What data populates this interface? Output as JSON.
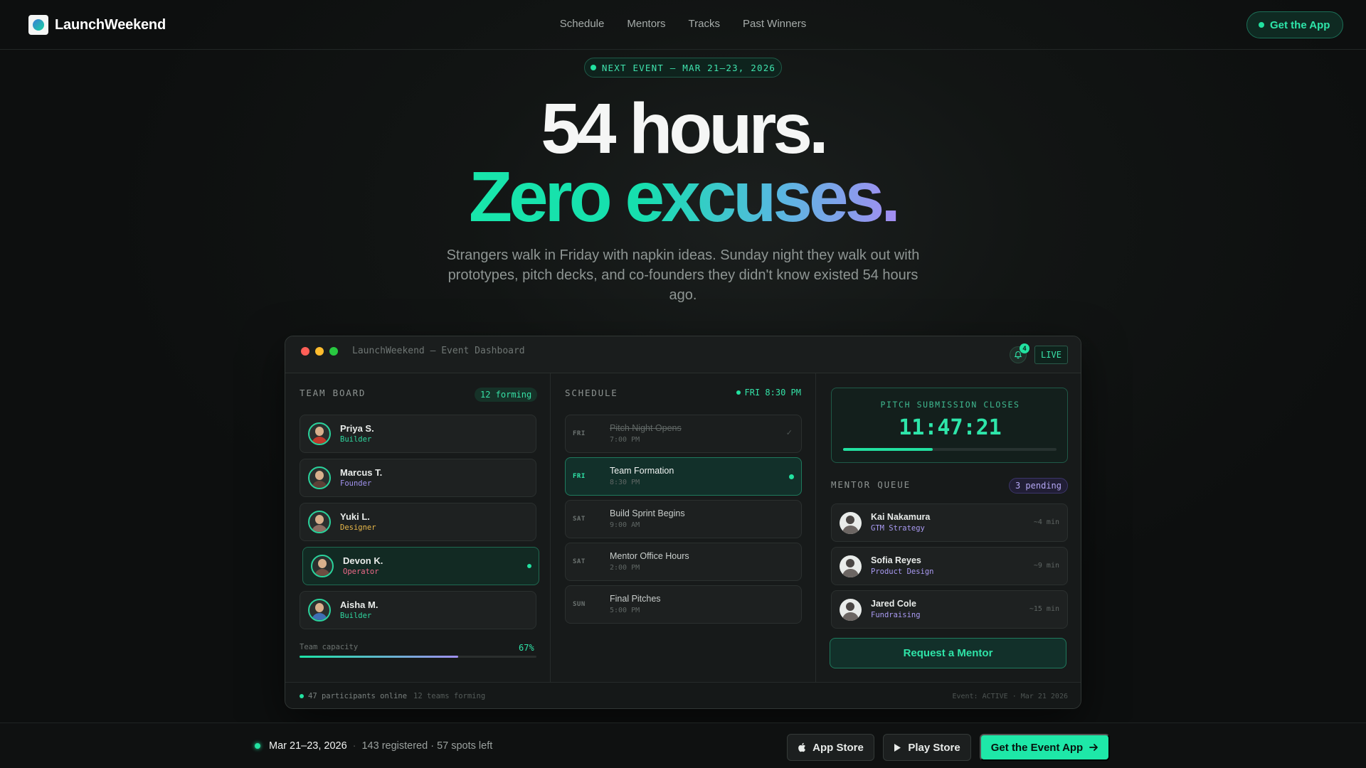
{
  "nav": {
    "brand": "LaunchWeekend",
    "links": [
      "Schedule",
      "Mentors",
      "Tracks",
      "Past Winners"
    ],
    "cta": "Get the App"
  },
  "hero": {
    "event_pill": "NEXT EVENT — MAR 21–23, 2026",
    "line1": "54 hours.",
    "line2": "Zero excuses.",
    "subtitle": "Strangers walk in Friday with napkin ideas. Sunday night they walk out with prototypes, pitch decks, and co-founders they didn't know existed 54 hours ago."
  },
  "dashboard": {
    "window_title": "LaunchWeekend — Event Dashboard",
    "notification_count": "4",
    "live_label": "LIVE",
    "team_board": {
      "title": "TEAM BOARD",
      "badge": "12 forming",
      "members": [
        {
          "name": "Priya S.",
          "role": "Builder",
          "role_color": "#2fd79f",
          "avatar_color": "#c0392b",
          "active": false
        },
        {
          "name": "Marcus T.",
          "role": "Founder",
          "role_color": "#a193f0",
          "avatar_color": "#5d4037",
          "active": false
        },
        {
          "name": "Yuki L.",
          "role": "Designer",
          "role_color": "#e8b84a",
          "avatar_color": "#8d6e63",
          "active": false
        },
        {
          "name": "Devon K.",
          "role": "Operator",
          "role_color": "#f06a8a",
          "avatar_color": "#6d4c41",
          "active": true
        },
        {
          "name": "Aisha M.",
          "role": "Builder",
          "role_color": "#2fd79f",
          "avatar_color": "#3f6fb5",
          "active": false
        }
      ],
      "capacity_label": "Team capacity",
      "capacity_value": "67%",
      "capacity_fraction": 0.67
    },
    "schedule": {
      "title": "SCHEDULE",
      "now": "FRI 8:30 PM",
      "items": [
        {
          "day": "FRI",
          "title": "Pitch Night Opens",
          "time": "7:00 PM",
          "state": "done"
        },
        {
          "day": "FRI",
          "title": "Team Formation",
          "time": "8:30 PM",
          "state": "current"
        },
        {
          "day": "SAT",
          "title": "Build Sprint Begins",
          "time": "9:00 AM",
          "state": "upcoming"
        },
        {
          "day": "SAT",
          "title": "Mentor Office Hours",
          "time": "2:00 PM",
          "state": "upcoming"
        },
        {
          "day": "SUN",
          "title": "Final Pitches",
          "time": "5:00 PM",
          "state": "upcoming"
        }
      ]
    },
    "pitch": {
      "label": "PITCH SUBMISSION CLOSES",
      "timer": "11:47:21",
      "progress_fraction": 0.42
    },
    "mentor_queue": {
      "title": "MENTOR QUEUE",
      "badge": "3 pending",
      "mentors": [
        {
          "name": "Kai Nakamura",
          "topic": "GTM Strategy",
          "wait": "~4 min"
        },
        {
          "name": "Sofia Reyes",
          "topic": "Product Design",
          "wait": "~9 min"
        },
        {
          "name": "Jared Cole",
          "topic": "Fundraising",
          "wait": "~15 min"
        }
      ],
      "button": "Request a Mentor"
    },
    "footer": {
      "online": "47 participants online",
      "teams": "12 teams forming",
      "status": "Event: ACTIVE · Mar 21 2026"
    }
  },
  "bottom_bar": {
    "date": "Mar 21–23, 2026",
    "separator": "·",
    "registration": "143 registered · 57 spots left",
    "app_store": "App Store",
    "play_store": "Play Store",
    "cta": "Get the Event App"
  },
  "colors": {
    "accent": "#22e1a0",
    "purple": "#a193f0",
    "background": "#121514"
  }
}
